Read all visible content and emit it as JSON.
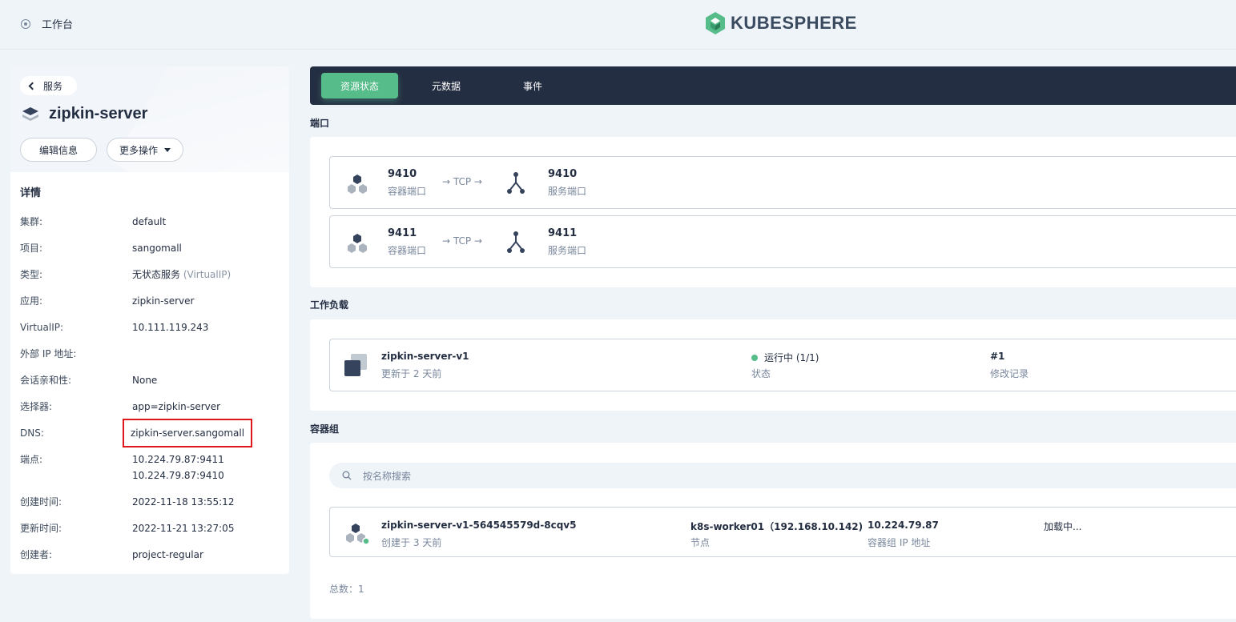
{
  "topbar": {
    "workbench": "工作台",
    "logo_text": "KUBESPHERE"
  },
  "left": {
    "back_label": "服务",
    "service_name": "zipkin-server",
    "edit_label": "编辑信息",
    "more_label": "更多操作",
    "details_title": "详情",
    "details": [
      {
        "key": "集群:",
        "value": "default"
      },
      {
        "key": "项目:",
        "value": "sangomall"
      },
      {
        "key": "类型:",
        "value": "无状态服务",
        "value_extra": "(VirtualIP)"
      },
      {
        "key": "应用:",
        "value": "zipkin-server"
      },
      {
        "key": "VirtualIP:",
        "value": "10.111.119.243"
      },
      {
        "key": "外部 IP 地址:",
        "value": ""
      },
      {
        "key": "会话亲和性:",
        "value": "None"
      },
      {
        "key": "选择器:",
        "value": "app=zipkin-server"
      },
      {
        "key": "DNS:",
        "value": "zipkin-server.sangomall"
      },
      {
        "key": "端点:",
        "value": "10.224.79.87:9411",
        "value_line2": "10.224.79.87:9410"
      },
      {
        "key": "创建时间:",
        "value": "2022-11-18 13:55:12"
      },
      {
        "key": "更新时间:",
        "value": "2022-11-21 13:27:05"
      },
      {
        "key": "创建者:",
        "value": "project-regular"
      }
    ]
  },
  "tabs": [
    "资源状态",
    "元数据",
    "事件"
  ],
  "ports": {
    "label": "端口",
    "items": [
      {
        "container_port": "9410",
        "container_label": "容器端口",
        "protocol": "→ TCP →",
        "service_port": "9410",
        "service_label": "服务端口"
      },
      {
        "container_port": "9411",
        "container_label": "容器端口",
        "protocol": "→ TCP →",
        "service_port": "9411",
        "service_label": "服务端口"
      }
    ]
  },
  "workload": {
    "label": "工作负载",
    "name": "zipkin-server-v1",
    "updated": "更新于 2 天前",
    "status": "运行中 (1/1)",
    "status_label": "状态",
    "revision": "#1",
    "revision_label": "修改记录"
  },
  "pods": {
    "label": "容器组",
    "search_placeholder": "按名称搜索",
    "name": "zipkin-server-v1-564545579d-8cqv5",
    "created": "创建于 3 天前",
    "node": "k8s-worker01（192.168.10.142)",
    "node_label": "节点",
    "ip": "10.224.79.87",
    "ip_label": "容器组 IP 地址",
    "loading": "加载中...",
    "total": "总数：1"
  },
  "colors": {
    "accent": "#55bc8a",
    "dark": "#242e42",
    "highlight_border": "#e0161b"
  }
}
